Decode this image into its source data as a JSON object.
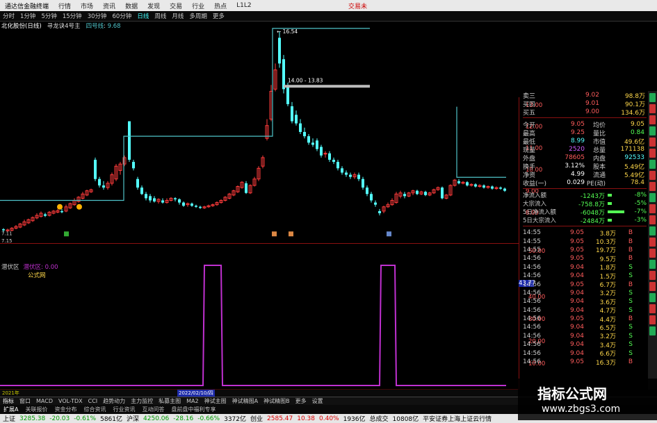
{
  "menubar": {
    "app_title": "通达信金融终端",
    "items": [
      "行情",
      "市场",
      "资讯",
      "数据",
      "发现",
      "交易",
      "行业",
      "热点",
      "L1L2"
    ],
    "right": "交易未"
  },
  "periodbar": {
    "items": [
      "分时",
      "1分钟",
      "5分钟",
      "15分钟",
      "30分钟",
      "60分钟",
      "日线",
      "周线",
      "月线",
      "多周期",
      "更多"
    ],
    "active": "日线"
  },
  "stockline": {
    "name": "北化股份(日线)",
    "indicator": "寻龙诀4号主",
    "line_label": "四号线",
    "line_value": "9.68"
  },
  "chart": {
    "high_label": "16.54",
    "range_label": "14.00 - 13.83",
    "low_label": "7.11",
    "bottom_low_label": "7.15",
    "y_ticks": [
      "13.00",
      "12.00",
      "11.00",
      "10.00",
      "9.00",
      "8.00"
    ]
  },
  "subpanel": {
    "name": "潜伏区",
    "indicator_label": "潜伏区",
    "indicator_value": "0.00",
    "formula_label": "公式网",
    "marker_value": "43.77",
    "y_ticks": [
      "50.00",
      "40.00",
      "30.00",
      "20.00",
      "10.00"
    ]
  },
  "quote": {
    "top_rows": [
      {
        "label": "卖三",
        "price": "9.02",
        "vol": "98.8万"
      },
      {
        "label": "买四",
        "price": "9.01",
        "vol": "90.1万"
      },
      {
        "label": "买五",
        "price": "9.00",
        "vol": "134.6万"
      }
    ],
    "stats": [
      {
        "l1": "今开",
        "v1": "9.05",
        "l2": "均价",
        "v2": "9.05"
      },
      {
        "l1": "最高",
        "v1": "9.25",
        "l2": "量比",
        "v2": "0.84"
      },
      {
        "l1": "最低",
        "v1": "8.99",
        "l2": "市值",
        "v2": "49.6亿"
      },
      {
        "l1": "现量",
        "v1": "2520",
        "l2": "总量",
        "v2": "171138"
      },
      {
        "l1": "外盘",
        "v1": "78605",
        "l2": "内盘",
        "v2": "92533"
      },
      {
        "l1": "换手",
        "v1": "3.12%",
        "l2": "股本",
        "v2": "5.49亿"
      },
      {
        "l1": "净资",
        "v1": "4.99",
        "l2": "流通",
        "v2": "5.49亿"
      },
      {
        "l1": "收益(一)",
        "v1": "0.029",
        "l2": "PE(动)",
        "v2": "78.4"
      }
    ],
    "flows": [
      {
        "label": "净流入额",
        "value": "-1243万",
        "pct": "-8%"
      },
      {
        "label": "大宗流入",
        "value": "-758.8万",
        "pct": "-5%"
      },
      {
        "label": "5日净流入额",
        "value": "-6048万",
        "pct": "-7%"
      },
      {
        "label": "5日大宗流入",
        "value": "-2484万",
        "pct": "-3%"
      }
    ],
    "ticks": [
      {
        "t": "14:55",
        "p": "9.05",
        "v": "3.8万",
        "d": "B"
      },
      {
        "t": "14:55",
        "p": "9.05",
        "v": "10.3万",
        "d": "B"
      },
      {
        "t": "14:55",
        "p": "9.05",
        "v": "19.7万",
        "d": "B"
      },
      {
        "t": "14:56",
        "p": "9.05",
        "v": "9.5万",
        "d": "B"
      },
      {
        "t": "14:56",
        "p": "9.04",
        "v": "1.8万",
        "d": "S"
      },
      {
        "t": "14:56",
        "p": "9.04",
        "v": "1.5万",
        "d": "S"
      },
      {
        "t": "14:56",
        "p": "9.05",
        "v": "6.7万",
        "d": "B"
      },
      {
        "t": "14:56",
        "p": "9.04",
        "v": "3.2万",
        "d": "S"
      },
      {
        "t": "14:56",
        "p": "9.04",
        "v": "3.6万",
        "d": "S"
      },
      {
        "t": "14:56",
        "p": "9.04",
        "v": "4.7万",
        "d": "S"
      },
      {
        "t": "14:56",
        "p": "9.05",
        "v": "4.4万",
        "d": "B"
      },
      {
        "t": "14:56",
        "p": "9.04",
        "v": "6.5万",
        "d": "S"
      },
      {
        "t": "14:56",
        "p": "9.04",
        "v": "3.2万",
        "d": "S"
      },
      {
        "t": "14:56",
        "p": "9.04",
        "v": "3.4万",
        "d": "S"
      },
      {
        "t": "14:56",
        "p": "9.04",
        "v": "6.6万",
        "d": "S"
      },
      {
        "t": "14:56",
        "p": "9.05",
        "v": "16.3万",
        "d": "B"
      }
    ]
  },
  "xlabels": {
    "start": "2021年",
    "cursor_date": "2022/02/10/四"
  },
  "tabs": [
    "指标",
    "窗口",
    "MACD",
    "VOL-TDX",
    "CCI",
    "趋势动力",
    "主力监控",
    "私募主图",
    "MA2",
    "神试主图",
    "神试精图A",
    "神试精图B",
    "更多",
    "设置"
  ],
  "sub_tabs": [
    "扩展A",
    "关联报价",
    "资金分布",
    "综合资讯",
    "行业资讯",
    "互动问答",
    "盘前盘中福利专享"
  ],
  "statusbar": {
    "sh_label": "上证",
    "sh_value": "3285.38",
    "sh_change": "-20.03",
    "sh_pct": "-0.61%",
    "sh_amount": "5861亿",
    "sz_label": "沪深",
    "sz_value": "4250.06",
    "sz_change": "-28.16",
    "sz_pct": "-0.66%",
    "sz_amount": "3372亿",
    "cy_label": "创业",
    "cy_value": "2585.47",
    "cy_change": "10.38",
    "cy_pct": "0.40%",
    "cy_amount": "1936亿",
    "total_label": "总成交",
    "total_value": "10808亿",
    "broker": "平安证券上海上证云行情"
  },
  "watermark": {
    "title": "指标公式网",
    "url": "www.zbgs3.com"
  },
  "colors": {
    "up": "#ff3b3b",
    "down": "#54ffff",
    "line": "#4fc3c9",
    "ma": "#ffffff",
    "purple": "#c030d0",
    "grid": "#7a1010"
  }
}
